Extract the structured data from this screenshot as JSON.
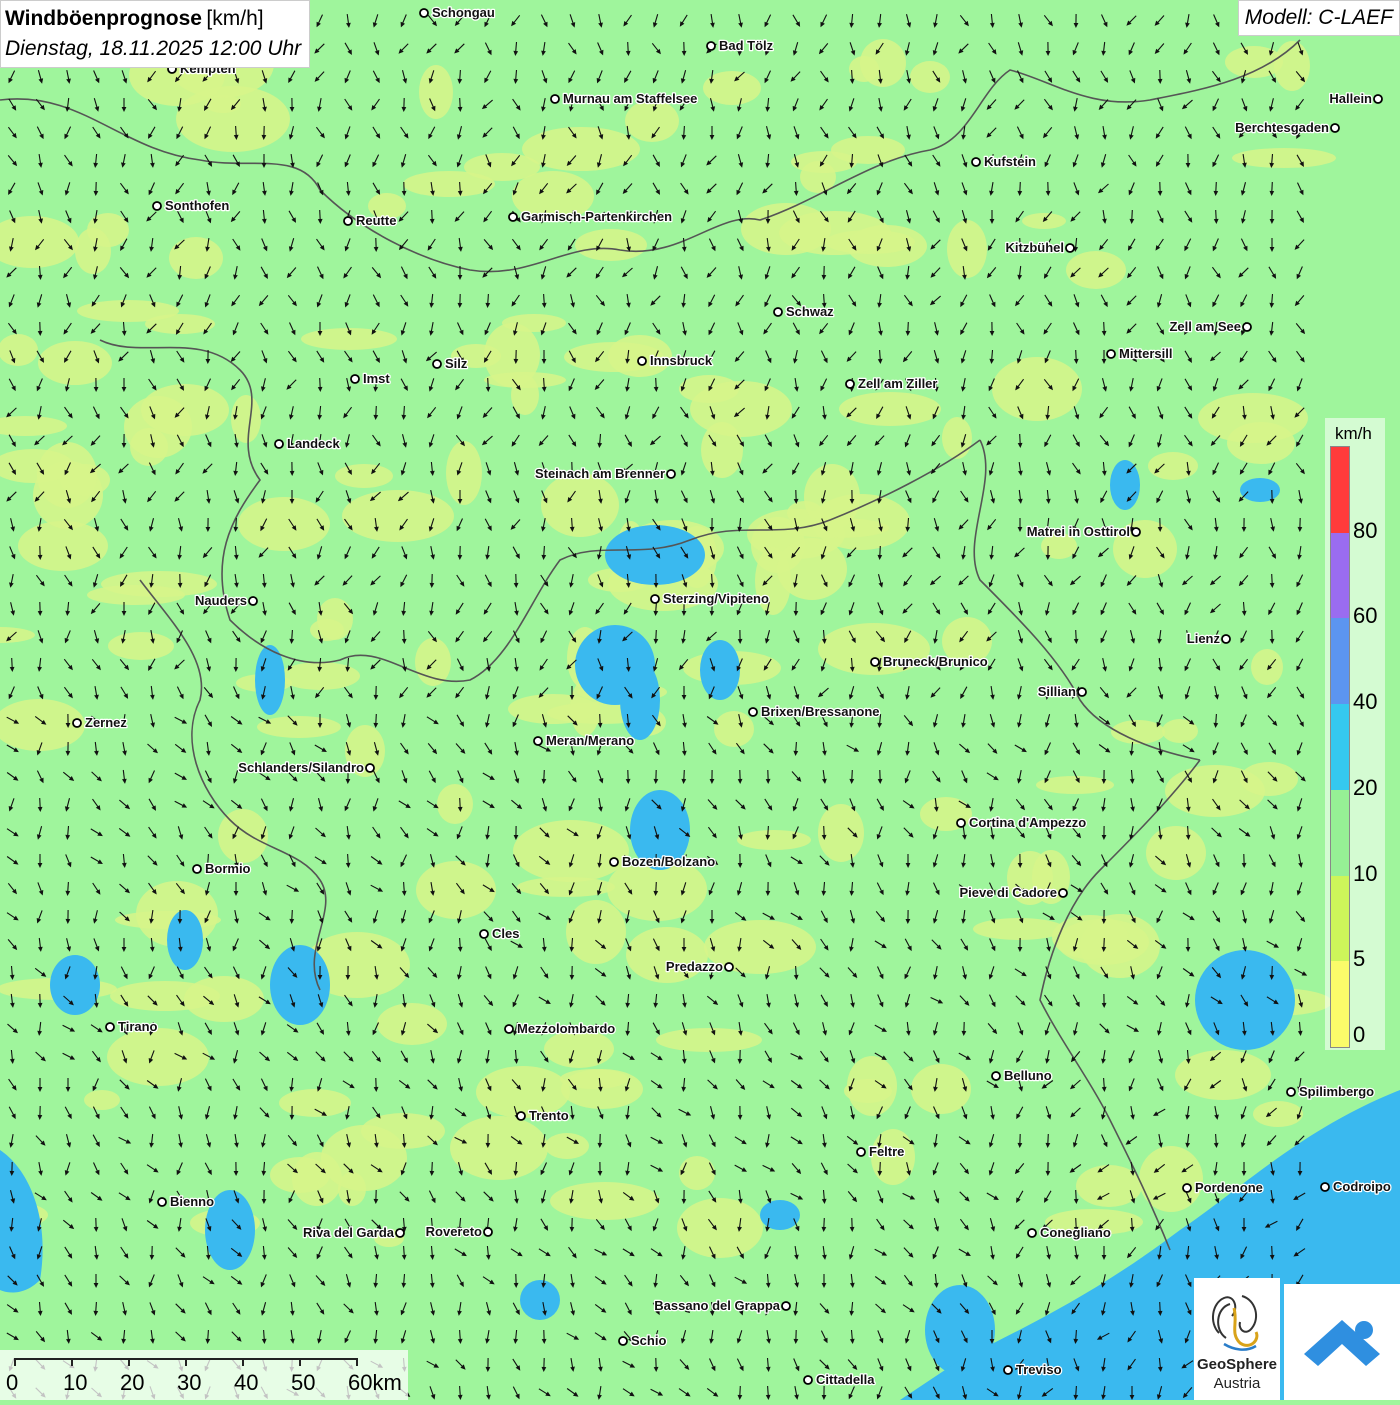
{
  "header": {
    "title": "Windböenprognose",
    "unit": "[km/h]",
    "datetime": "Dienstag, 18.11.2025 12:00 Uhr"
  },
  "model": "Modell: C-LAEF",
  "legend": {
    "unit": "km/h",
    "ticks": [
      "80",
      "60",
      "40",
      "20",
      "10",
      "5",
      "0"
    ],
    "colors": [
      "#ff3b3b",
      "#9a6cf0",
      "#5c95f0",
      "#35c8ef",
      "#96f095",
      "#cdf55a",
      "#fbfb6a"
    ]
  },
  "scale_bar": {
    "labels": [
      "0",
      "10",
      "20",
      "30",
      "40",
      "50",
      "60km"
    ]
  },
  "branding": {
    "logo_line1": "GeoSphere",
    "logo_line2": "Austria",
    "logo_icon": "geosphere-logo-icon",
    "app_icon": "wind-app-icon"
  },
  "colors": {
    "background": "#9ff59c",
    "yellow_band": "#d7f58a",
    "blue_band": "#3ab9ef",
    "border": "#555555"
  },
  "cities": [
    {
      "name": "Schongau"
    },
    {
      "name": "Bad Tölz"
    },
    {
      "name": "Kempten"
    },
    {
      "name": "Murnau am Staffelsee"
    },
    {
      "name": "Hallein"
    },
    {
      "name": "Berchtesgaden"
    },
    {
      "name": "Kufstein"
    },
    {
      "name": "Sonthofen"
    },
    {
      "name": "Reutte"
    },
    {
      "name": "Garmisch-Partenkirchen"
    },
    {
      "name": "Kitzbühel"
    },
    {
      "name": "Schwaz"
    },
    {
      "name": "Zell am See"
    },
    {
      "name": "Mittersill"
    },
    {
      "name": "Silz"
    },
    {
      "name": "Innsbruck"
    },
    {
      "name": "Imst"
    },
    {
      "name": "Zell am Ziller"
    },
    {
      "name": "Landeck"
    },
    {
      "name": "Steinach am Brenner"
    },
    {
      "name": "Matrei in Osttirol"
    },
    {
      "name": "Nauders"
    },
    {
      "name": "Sterzing/Vipiteno"
    },
    {
      "name": "Lienz"
    },
    {
      "name": "Bruneck/Brunico"
    },
    {
      "name": "Sillian"
    },
    {
      "name": "Zernez"
    },
    {
      "name": "Brixen/Bressanone"
    },
    {
      "name": "Meran/Merano"
    },
    {
      "name": "Schlanders/Silandro"
    },
    {
      "name": "Cortina d'Ampezzo"
    },
    {
      "name": "Bozen/Bolzano"
    },
    {
      "name": "Bormio"
    },
    {
      "name": "Pieve di Cadore"
    },
    {
      "name": "Cles"
    },
    {
      "name": "Predazzo"
    },
    {
      "name": "Tirano"
    },
    {
      "name": "Mezzolombardo"
    },
    {
      "name": "Belluno"
    },
    {
      "name": "Spilimbergo"
    },
    {
      "name": "Trento"
    },
    {
      "name": "Feltre"
    },
    {
      "name": "Pordenone"
    },
    {
      "name": "Codroipo"
    },
    {
      "name": "Bienno"
    },
    {
      "name": "Riva del Garda"
    },
    {
      "name": "Rovereto"
    },
    {
      "name": "Conegliano"
    },
    {
      "name": "Bassano del Grappa"
    },
    {
      "name": "Schio"
    },
    {
      "name": "Treviso"
    },
    {
      "name": "Cittadella"
    }
  ]
}
